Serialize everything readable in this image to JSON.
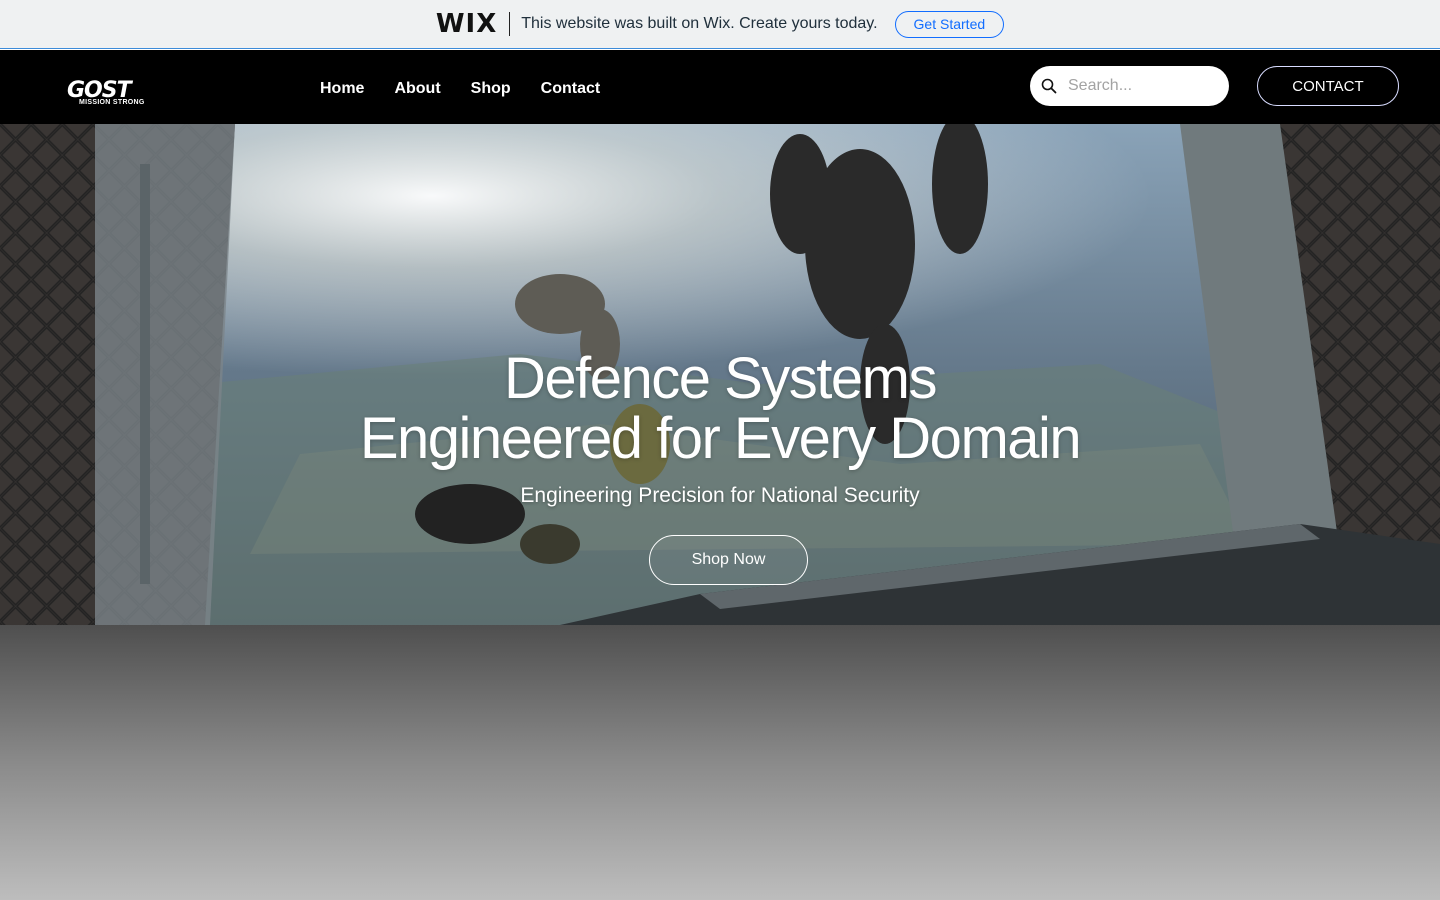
{
  "wix_banner": {
    "logo": "WIX",
    "message": "This website was built on Wix. Create yours today.",
    "cta_label": "Get Started"
  },
  "header": {
    "brand": {
      "word": "GOST",
      "tagline": "MISSION STRONG"
    },
    "nav": [
      {
        "label": "Home"
      },
      {
        "label": "About"
      },
      {
        "label": "Shop"
      },
      {
        "label": "Contact"
      }
    ],
    "search": {
      "placeholder": "Search...",
      "value": ""
    },
    "contact_button": "CONTACT"
  },
  "hero": {
    "title_line1": "Defence Systems",
    "title_line2": "Engineered for Every Domain",
    "subtitle": "Engineering Precision for National Security",
    "cta_label": "Shop Now"
  },
  "colors": {
    "banner_bg": "#eff1f2",
    "wix_blue": "#116dff",
    "header_bg": "#000000",
    "text_on_dark": "#ffffff"
  },
  "icons": {
    "search": "search-icon"
  }
}
